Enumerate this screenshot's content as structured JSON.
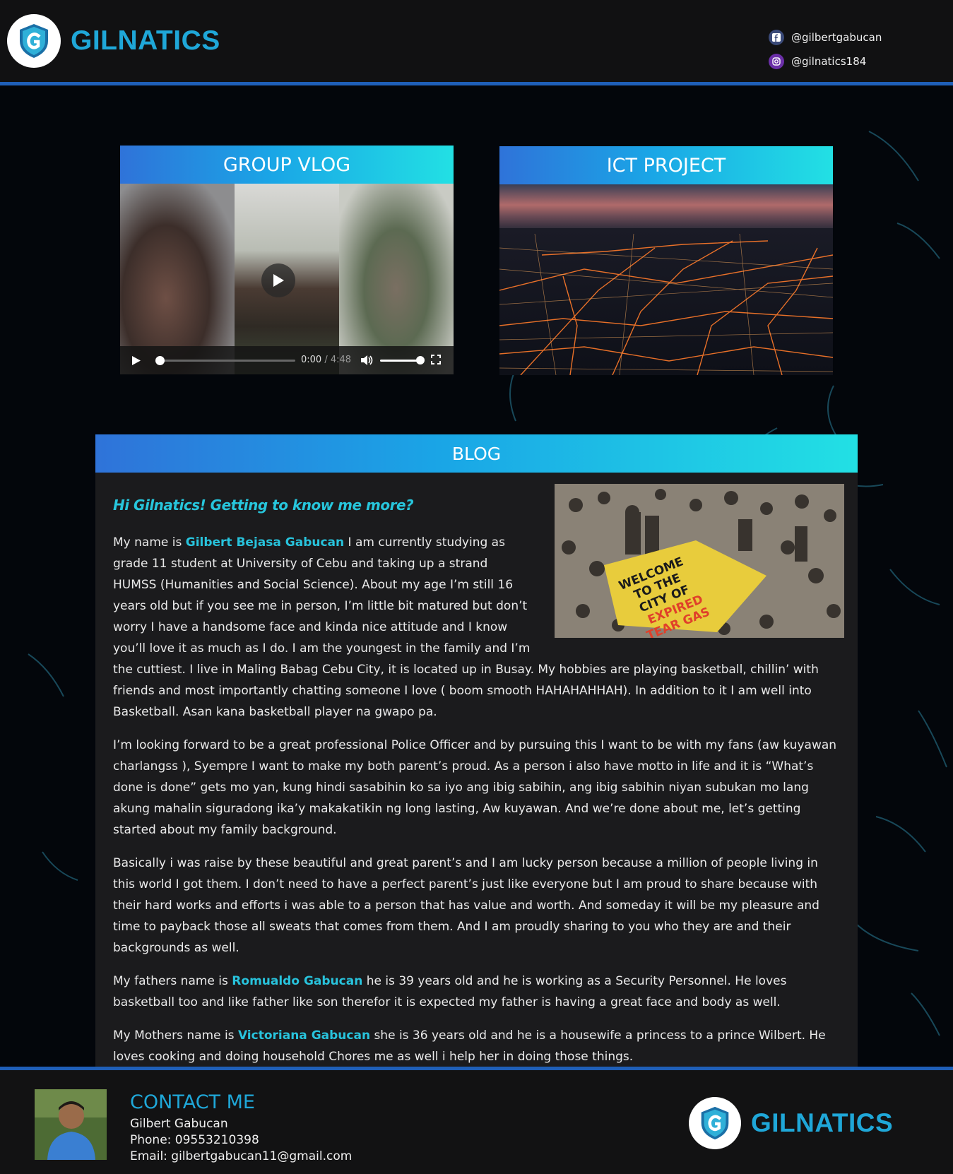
{
  "brand": {
    "name": "GILNATICS",
    "color": "#1fa7d8"
  },
  "social": {
    "facebook": "@gilbertgabucan",
    "instagram": "@gilnatics184"
  },
  "vlog": {
    "title": "GROUP VLOG",
    "time_current": "0:00",
    "time_separator": " / ",
    "time_duration": "4:48",
    "progress": 0,
    "volume": 1.0
  },
  "ict": {
    "title": "ICT PROJECT"
  },
  "blog": {
    "title": "BLOG",
    "heading": "Hi Gilnatics! Getting to know me more?",
    "p1_a": "My name is ",
    "p1_name": "Gilbert Bejasa Gabucan",
    "p1_b": " I am currently studying as grade 11 student at University of Cebu and taking up a strand HUMSS (Humanities and Social Science). About my age I’m still 16 years old but if you see me in person, I’m little bit matured but don’t worry I have a handsome face and kinda nice attitude and I know you’ll love it as much as I do. I am the youngest in the family and I’m the cuttiest. I live in Maling Babag Cebu City, it is located up in Busay. My hobbies are playing basketball, chillin’ with friends and most importantly chatting someone I love ( boom smooth HAHAHAHHAH). In addition to it I am well into Basketball. Asan kana basketball player na gwapo pa.",
    "p2": "I’m looking forward to be a great professional Police Officer and by pursuing this I want to be with my fans (aw kuyawan charlangss ), Syempre I want to make my both parent’s proud. As a person i also have motto in life and it is “What’s done is done” gets mo yan, kung hindi sasabihin ko sa iyo ang ibig sabihin, ang ibig sabihin niyan subukan mo lang akung mahalin siguradong ika’y makakatikin ng long lasting, Aw kuyawan. And we’re done about me, let’s getting started about my family background.",
    "p3": "Basically i was raise by these beautiful and great parent’s and I am lucky person because a million of people living in this world I got them. I don’t need to have a perfect parent’s just like everyone but I am proud to share because with their hard works and efforts i was able to a person that has value and worth. And someday it will be my pleasure and time to payback those all sweats that comes from them. And I am proudly sharing to you who they are and their backgrounds as well.",
    "p4_a": "My fathers name is ",
    "p4_name": "Romualdo Gabucan",
    "p4_b": " he is 39 years old and he is working as a Security Personnel. He loves basketball too and like father like son therefor it is expected my father is having a great face and body as well.",
    "p5_a": "My Mothers name is ",
    "p5_name": "Victoriana Gabucan",
    "p5_b": " she is 36 years old and he is a housewife a princess to a prince Wilbert. He loves cooking and doing household Chores me as well i help her in doing those things.",
    "image_sign_lines": [
      "WELCOME",
      "TO THE",
      "CITY OF",
      "EXPIRED",
      "TEAR GAS"
    ]
  },
  "contact": {
    "title": "CONTACT ME",
    "name": "Gilbert Gabucan",
    "phone": "Phone: 09553210398",
    "email": "Email: gilbertgabucan11@gmail.com"
  }
}
